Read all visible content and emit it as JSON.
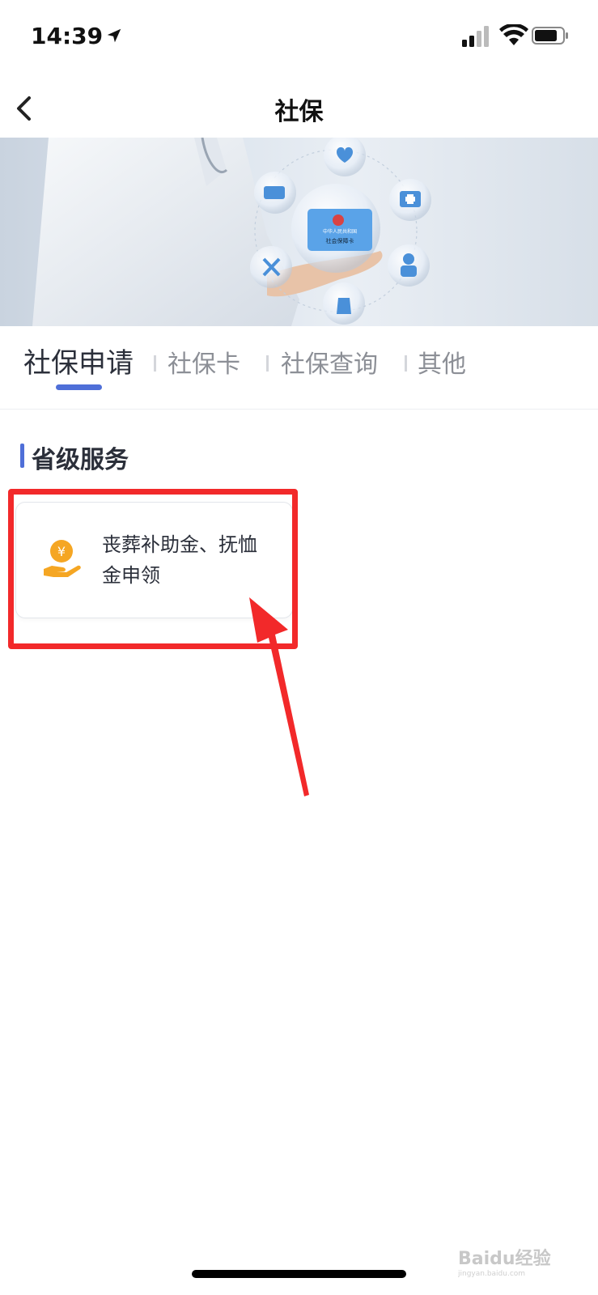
{
  "status_bar": {
    "time": "14:39",
    "location_icon": "location-arrow-icon",
    "signal_icon": "cellular-signal-icon",
    "wifi_icon": "wifi-icon",
    "battery_icon": "battery-icon"
  },
  "nav": {
    "title": "社保",
    "back_icon": "chevron-left-icon"
  },
  "banner": {
    "card_line1": "中华人民共和国",
    "card_line2": "社会保障卡"
  },
  "tabs": [
    {
      "label": "社保申请",
      "active": true
    },
    {
      "label": "社保卡",
      "active": false
    },
    {
      "label": "社保查询",
      "active": false
    },
    {
      "label": "其他",
      "active": false
    }
  ],
  "section": {
    "title": "省级服务"
  },
  "services": [
    {
      "label": "丧葬补助金、抚恤金申领",
      "icon": "yuan-coin-hand-icon"
    }
  ],
  "watermark": {
    "text": "Baidu经验",
    "url": "jingyan.baidu.com"
  },
  "colors": {
    "accent": "#4f6fd8",
    "annotation_red": "#f2292a",
    "icon_orange": "#f5a623"
  }
}
